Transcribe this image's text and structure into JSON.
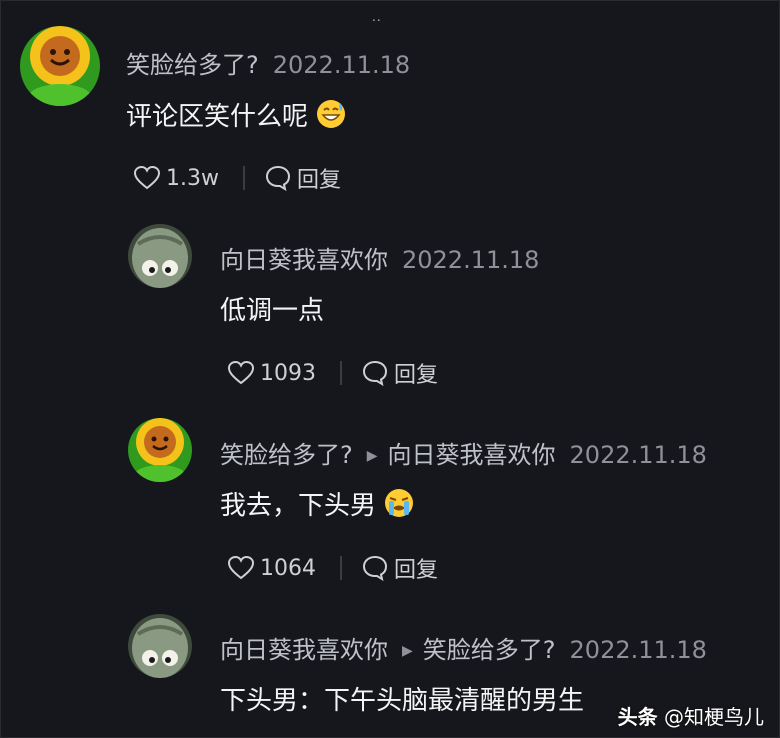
{
  "top_indicator": "..",
  "comments": [
    {
      "author": "笑脸给多了?",
      "date": "2022.11.18",
      "text": "评论区笑什么呢",
      "emoji": "grinning-sweat-icon",
      "likes": "1.3w",
      "reply_label": "回复"
    },
    {
      "author": "向日葵我喜欢你",
      "date": "2022.11.18",
      "text": "低调一点",
      "likes": "1093",
      "reply_label": "回复"
    },
    {
      "author": "笑脸给多了?",
      "reply_to": "向日葵我喜欢你",
      "date": "2022.11.18",
      "text": "我去，下头男",
      "emoji": "crying-icon",
      "likes": "1064",
      "reply_label": "回复"
    },
    {
      "author": "向日葵我喜欢你",
      "reply_to": "笑脸给多了?",
      "date": "2022.11.18",
      "text": "下头男：下午头脑最清醒的男生"
    }
  ],
  "watermark": {
    "brand": "头条",
    "handle": "@知梗鸟儿"
  },
  "colors": {
    "background": "#16171c",
    "name": "#bfc1c8",
    "date": "#8f9199",
    "text": "#f4f4f6"
  }
}
